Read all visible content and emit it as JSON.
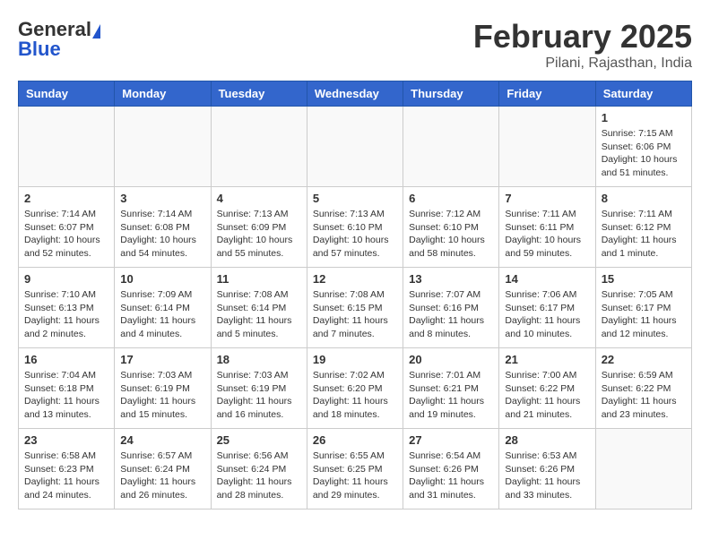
{
  "header": {
    "logo_general": "General",
    "logo_blue": "Blue",
    "month_title": "February 2025",
    "subtitle": "Pilani, Rajasthan, India"
  },
  "weekdays": [
    "Sunday",
    "Monday",
    "Tuesday",
    "Wednesday",
    "Thursday",
    "Friday",
    "Saturday"
  ],
  "weeks": [
    [
      {
        "day": "",
        "info": ""
      },
      {
        "day": "",
        "info": ""
      },
      {
        "day": "",
        "info": ""
      },
      {
        "day": "",
        "info": ""
      },
      {
        "day": "",
        "info": ""
      },
      {
        "day": "",
        "info": ""
      },
      {
        "day": "1",
        "info": "Sunrise: 7:15 AM\nSunset: 6:06 PM\nDaylight: 10 hours and 51 minutes."
      }
    ],
    [
      {
        "day": "2",
        "info": "Sunrise: 7:14 AM\nSunset: 6:07 PM\nDaylight: 10 hours and 52 minutes."
      },
      {
        "day": "3",
        "info": "Sunrise: 7:14 AM\nSunset: 6:08 PM\nDaylight: 10 hours and 54 minutes."
      },
      {
        "day": "4",
        "info": "Sunrise: 7:13 AM\nSunset: 6:09 PM\nDaylight: 10 hours and 55 minutes."
      },
      {
        "day": "5",
        "info": "Sunrise: 7:13 AM\nSunset: 6:10 PM\nDaylight: 10 hours and 57 minutes."
      },
      {
        "day": "6",
        "info": "Sunrise: 7:12 AM\nSunset: 6:10 PM\nDaylight: 10 hours and 58 minutes."
      },
      {
        "day": "7",
        "info": "Sunrise: 7:11 AM\nSunset: 6:11 PM\nDaylight: 10 hours and 59 minutes."
      },
      {
        "day": "8",
        "info": "Sunrise: 7:11 AM\nSunset: 6:12 PM\nDaylight: 11 hours and 1 minute."
      }
    ],
    [
      {
        "day": "9",
        "info": "Sunrise: 7:10 AM\nSunset: 6:13 PM\nDaylight: 11 hours and 2 minutes."
      },
      {
        "day": "10",
        "info": "Sunrise: 7:09 AM\nSunset: 6:14 PM\nDaylight: 11 hours and 4 minutes."
      },
      {
        "day": "11",
        "info": "Sunrise: 7:08 AM\nSunset: 6:14 PM\nDaylight: 11 hours and 5 minutes."
      },
      {
        "day": "12",
        "info": "Sunrise: 7:08 AM\nSunset: 6:15 PM\nDaylight: 11 hours and 7 minutes."
      },
      {
        "day": "13",
        "info": "Sunrise: 7:07 AM\nSunset: 6:16 PM\nDaylight: 11 hours and 8 minutes."
      },
      {
        "day": "14",
        "info": "Sunrise: 7:06 AM\nSunset: 6:17 PM\nDaylight: 11 hours and 10 minutes."
      },
      {
        "day": "15",
        "info": "Sunrise: 7:05 AM\nSunset: 6:17 PM\nDaylight: 11 hours and 12 minutes."
      }
    ],
    [
      {
        "day": "16",
        "info": "Sunrise: 7:04 AM\nSunset: 6:18 PM\nDaylight: 11 hours and 13 minutes."
      },
      {
        "day": "17",
        "info": "Sunrise: 7:03 AM\nSunset: 6:19 PM\nDaylight: 11 hours and 15 minutes."
      },
      {
        "day": "18",
        "info": "Sunrise: 7:03 AM\nSunset: 6:19 PM\nDaylight: 11 hours and 16 minutes."
      },
      {
        "day": "19",
        "info": "Sunrise: 7:02 AM\nSunset: 6:20 PM\nDaylight: 11 hours and 18 minutes."
      },
      {
        "day": "20",
        "info": "Sunrise: 7:01 AM\nSunset: 6:21 PM\nDaylight: 11 hours and 19 minutes."
      },
      {
        "day": "21",
        "info": "Sunrise: 7:00 AM\nSunset: 6:22 PM\nDaylight: 11 hours and 21 minutes."
      },
      {
        "day": "22",
        "info": "Sunrise: 6:59 AM\nSunset: 6:22 PM\nDaylight: 11 hours and 23 minutes."
      }
    ],
    [
      {
        "day": "23",
        "info": "Sunrise: 6:58 AM\nSunset: 6:23 PM\nDaylight: 11 hours and 24 minutes."
      },
      {
        "day": "24",
        "info": "Sunrise: 6:57 AM\nSunset: 6:24 PM\nDaylight: 11 hours and 26 minutes."
      },
      {
        "day": "25",
        "info": "Sunrise: 6:56 AM\nSunset: 6:24 PM\nDaylight: 11 hours and 28 minutes."
      },
      {
        "day": "26",
        "info": "Sunrise: 6:55 AM\nSunset: 6:25 PM\nDaylight: 11 hours and 29 minutes."
      },
      {
        "day": "27",
        "info": "Sunrise: 6:54 AM\nSunset: 6:26 PM\nDaylight: 11 hours and 31 minutes."
      },
      {
        "day": "28",
        "info": "Sunrise: 6:53 AM\nSunset: 6:26 PM\nDaylight: 11 hours and 33 minutes."
      },
      {
        "day": "",
        "info": ""
      }
    ]
  ]
}
